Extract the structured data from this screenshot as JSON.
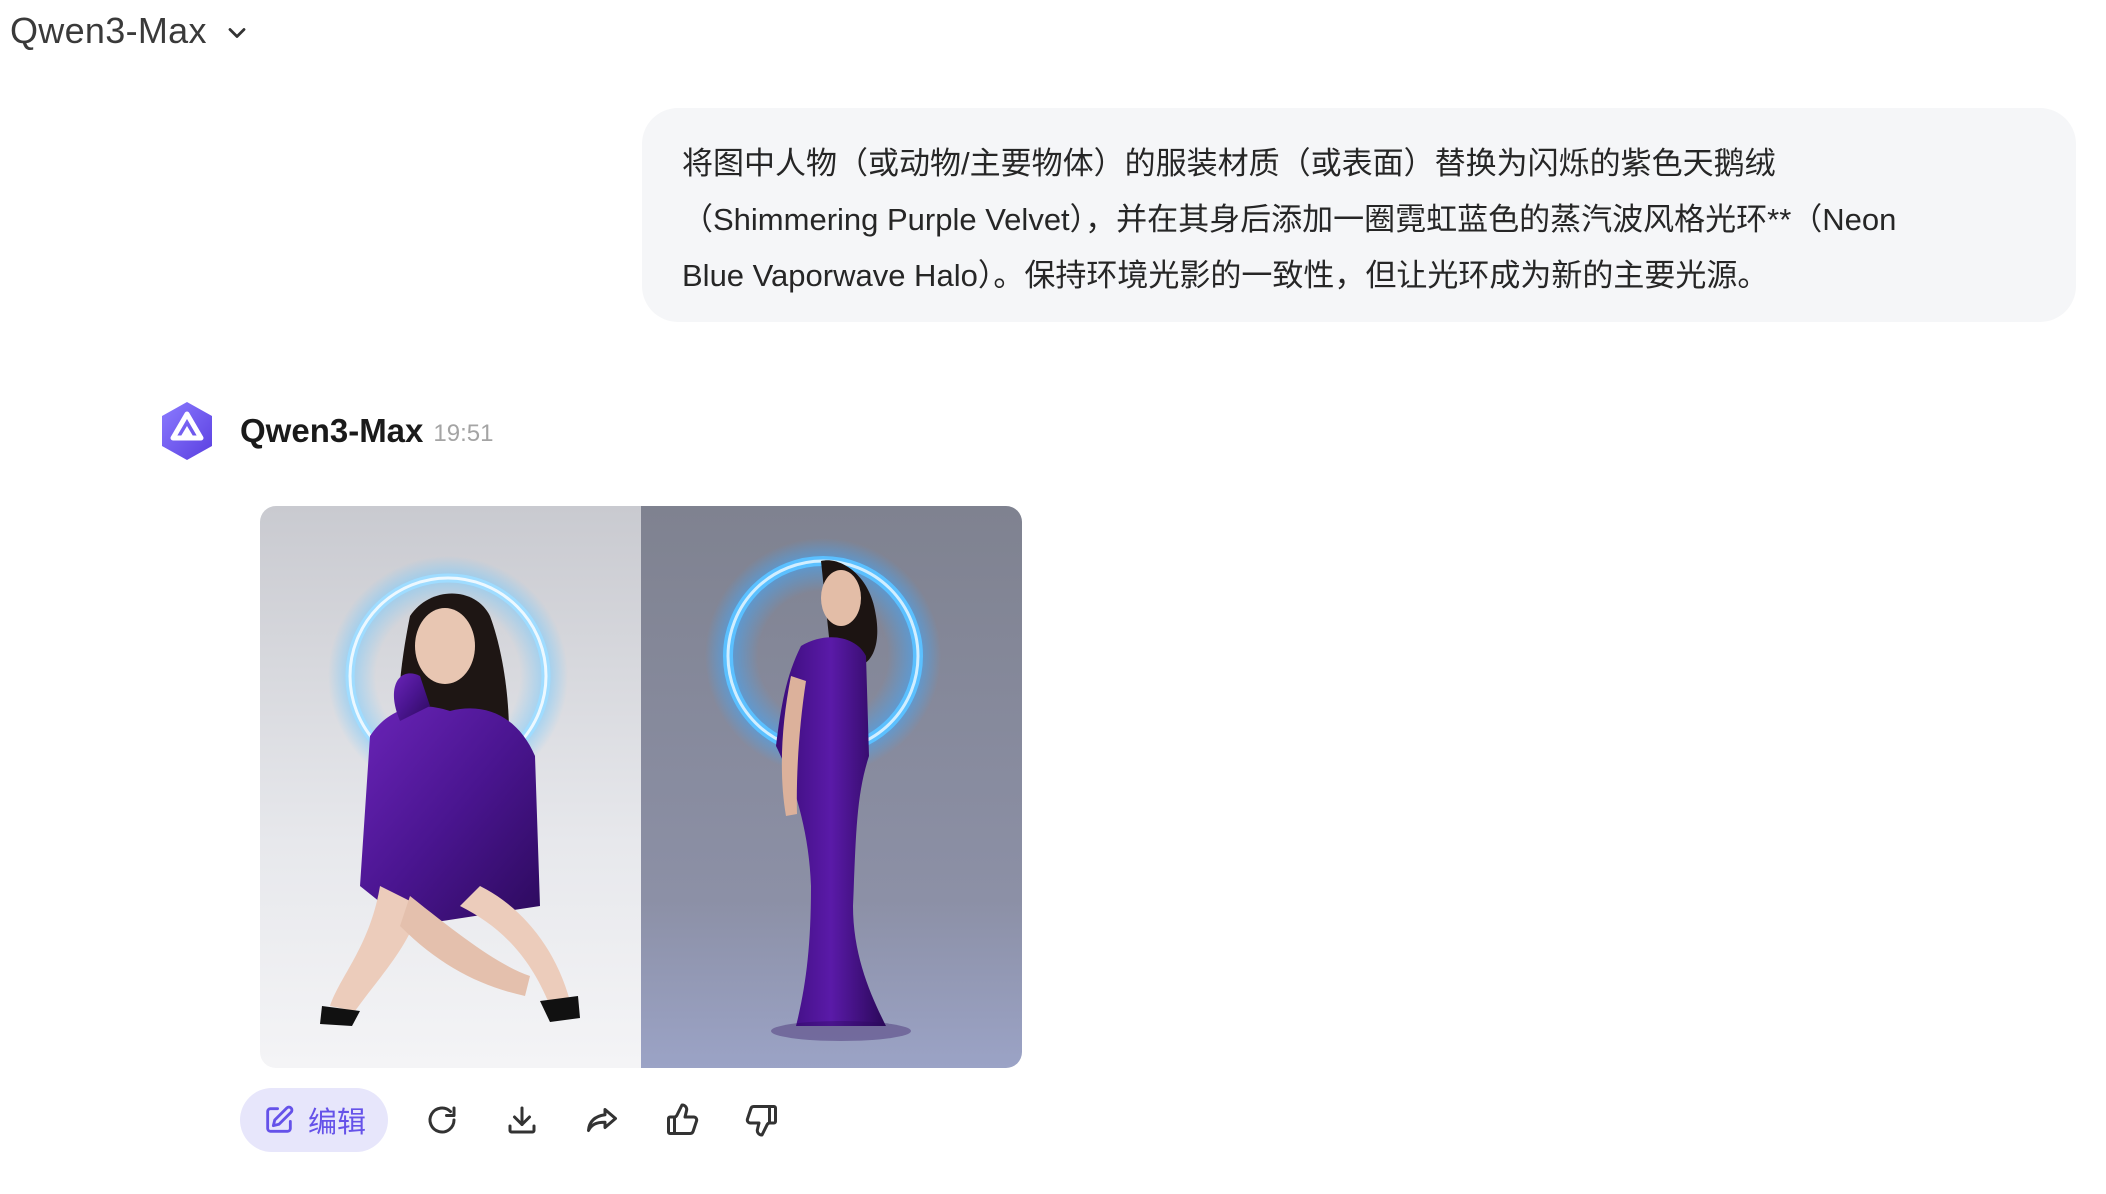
{
  "header": {
    "model_label": "Qwen3-Max",
    "dropdown_icon": "chevron-down-icon"
  },
  "user_message": {
    "text": "将图中人物（或动物/主要物体）的服装材质（或表面）替换为闪烁的紫色天鹅绒\n（Shimmering Purple Velvet），并在其身后添加一圈霓虹蓝色的蒸汽波风格光环**（Neon\nBlue Vaporwave Halo）。保持环境光影的一致性，但让光环成为新的主要光源。"
  },
  "assistant_message": {
    "name": "Qwen3-Max",
    "time": "19:51",
    "avatar_icon": "qwen-logo-icon",
    "images": [
      {
        "description_icon": "generated-image-seated"
      },
      {
        "description_icon": "generated-image-standing"
      }
    ]
  },
  "actions": {
    "edit_label": "编辑",
    "icons": [
      "edit-icon",
      "regenerate-icon",
      "download-icon",
      "share-icon",
      "thumbs-up-icon",
      "thumbs-down-icon"
    ]
  },
  "colors": {
    "accent": "#6552e9",
    "accent_bg": "#e7e6fb",
    "bubble_bg": "#f5f6f8",
    "velvet": "#4a1590",
    "halo": "#4fb8ff"
  }
}
